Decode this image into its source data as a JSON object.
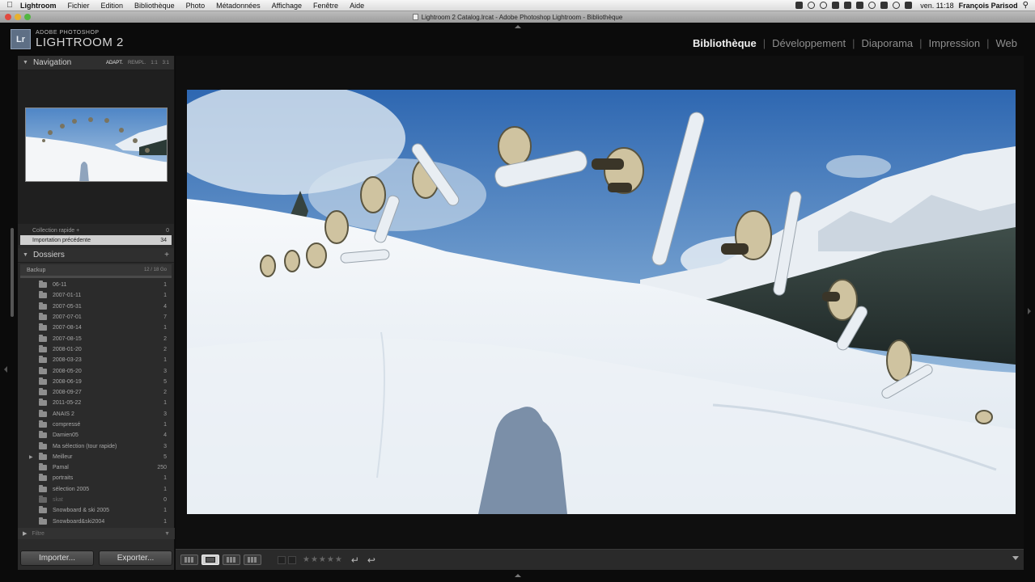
{
  "menubar": {
    "app_name": "Lightroom",
    "items": [
      "Fichier",
      "Edition",
      "Bibliothèque",
      "Photo",
      "Métadonnées",
      "Affichage",
      "Fenêtre",
      "Aide"
    ],
    "clock": "ven. 11:18",
    "user": "François Parisod"
  },
  "window": {
    "title": "Lightroom 2 Catalog.lrcat - Adobe Photoshop Lightroom - Bibliothèque"
  },
  "brand": {
    "badge": "Lr",
    "line1": "ADOBE PHOTOSHOP",
    "line2": "LIGHTROOM 2"
  },
  "modules": [
    "Bibliothèque",
    "Développement",
    "Diaporama",
    "Impression",
    "Web"
  ],
  "active_module": "Bibliothèque",
  "navigator": {
    "title": "Navigation",
    "options": [
      "ADAPT.",
      "REMPL.",
      "1:1",
      "3:1"
    ]
  },
  "collections": [
    {
      "label": "Collection rapide +",
      "count": "0"
    },
    {
      "label": "Importation précédente",
      "count": "34",
      "selected": true
    }
  ],
  "folders": {
    "title": "Dossiers",
    "volume": {
      "name": "Backup",
      "capacity": "12 / 18 Go"
    },
    "items": [
      {
        "name": "06-11",
        "count": "1"
      },
      {
        "name": "2007-01-11",
        "count": "1"
      },
      {
        "name": "2007-05-31",
        "count": "4"
      },
      {
        "name": "2007-07-01",
        "count": "7"
      },
      {
        "name": "2007-08-14",
        "count": "1"
      },
      {
        "name": "2007-08-15",
        "count": "2"
      },
      {
        "name": "2008-01-20",
        "count": "2"
      },
      {
        "name": "2008-03-23",
        "count": "1"
      },
      {
        "name": "2008-05-20",
        "count": "3"
      },
      {
        "name": "2008-06-19",
        "count": "5"
      },
      {
        "name": "2008-09-27",
        "count": "2"
      },
      {
        "name": "2011-05-22",
        "count": "1"
      },
      {
        "name": "ANAIS 2",
        "count": "3"
      },
      {
        "name": "compressé",
        "count": "1"
      },
      {
        "name": "Damien05",
        "count": "4"
      },
      {
        "name": "Ma sélection (tour rapide)",
        "count": "3"
      },
      {
        "name": "Meilleur",
        "count": "5",
        "expandable": true
      },
      {
        "name": "Pamal",
        "count": "250"
      },
      {
        "name": "portraits",
        "count": "1"
      },
      {
        "name": "sélection 2005",
        "count": "1"
      },
      {
        "name": "skat",
        "count": "0",
        "dim": true
      },
      {
        "name": "Snowboard & ski 2005",
        "count": "1"
      },
      {
        "name": "Snowboard&ski2004",
        "count": "1"
      }
    ]
  },
  "filter": {
    "label": "Filtre"
  },
  "buttons": {
    "import": "Importer...",
    "export": "Exporter..."
  },
  "toolbar": {
    "stars": "★★★★★"
  },
  "colors": {
    "accent": "#5e6f85",
    "panel": "#2b2b2b",
    "background": "#0b0b0b"
  }
}
